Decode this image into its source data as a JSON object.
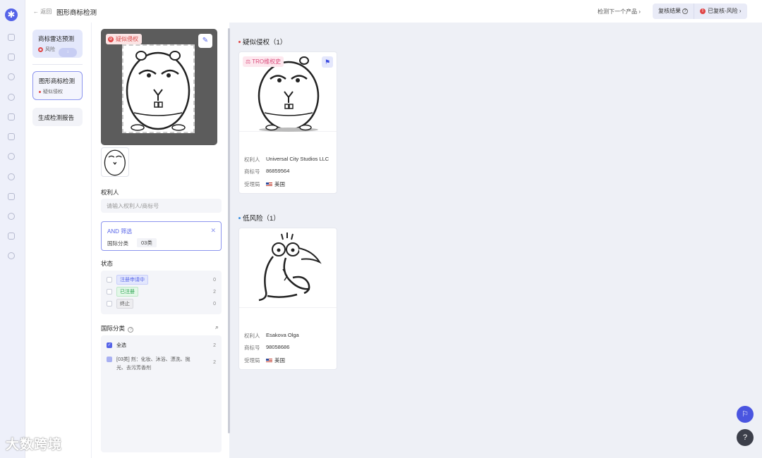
{
  "header": {
    "back_label": "返回",
    "title": "图形商标检测",
    "next_product": "检测下一个产品",
    "review_result": "复核结果",
    "reviewed_status": "已复核-风险"
  },
  "steps": [
    {
      "name": "商标雷达预测",
      "status": "风险"
    },
    {
      "name": "图形商标检测",
      "status": "疑似侵权"
    },
    {
      "name": "生成检测报告",
      "status": ""
    }
  ],
  "preview": {
    "tag": "疑似侵权"
  },
  "filter": {
    "owner_label": "权利人",
    "owner_placeholder": "请输入权利人/商标号",
    "and_title": "AND  筛选",
    "class_label": "国际分类",
    "class_value": "03类",
    "status_label": "状态",
    "statuses": [
      {
        "label": "注册申请中",
        "count": "0",
        "style": "blue"
      },
      {
        "label": "已注册",
        "count": "2",
        "style": "green"
      },
      {
        "label": "终止",
        "count": "0",
        "style": "gray"
      }
    ],
    "intl_class_label": "国际分类",
    "select_all": "全选",
    "select_all_count": "2",
    "class_item_line1": "[03类] 剂：化妆、沐浴、漂洗、抛",
    "class_item_line2": "光、去污芳香剂",
    "class_item_count": "2"
  },
  "groups": [
    {
      "title": "疑似侵权（1）",
      "color": "#e04545",
      "card": {
        "tag": "TRO维权史",
        "owner_key": "权利人",
        "owner": "Universal City Studios LLC",
        "number_key": "商标号",
        "number": "86859564",
        "office_key": "受理局",
        "office": "美国"
      }
    },
    {
      "title": "低风险（1）",
      "color": "#3a8fe0",
      "card": {
        "owner_key": "权利人",
        "owner": "Esakova Olga",
        "number_key": "商标号",
        "number": "98058686",
        "office_key": "受理局",
        "office": "美国"
      }
    }
  ],
  "watermark": "大数跨境",
  "colors": {
    "accent": "#5563e8",
    "danger": "#e04545"
  }
}
